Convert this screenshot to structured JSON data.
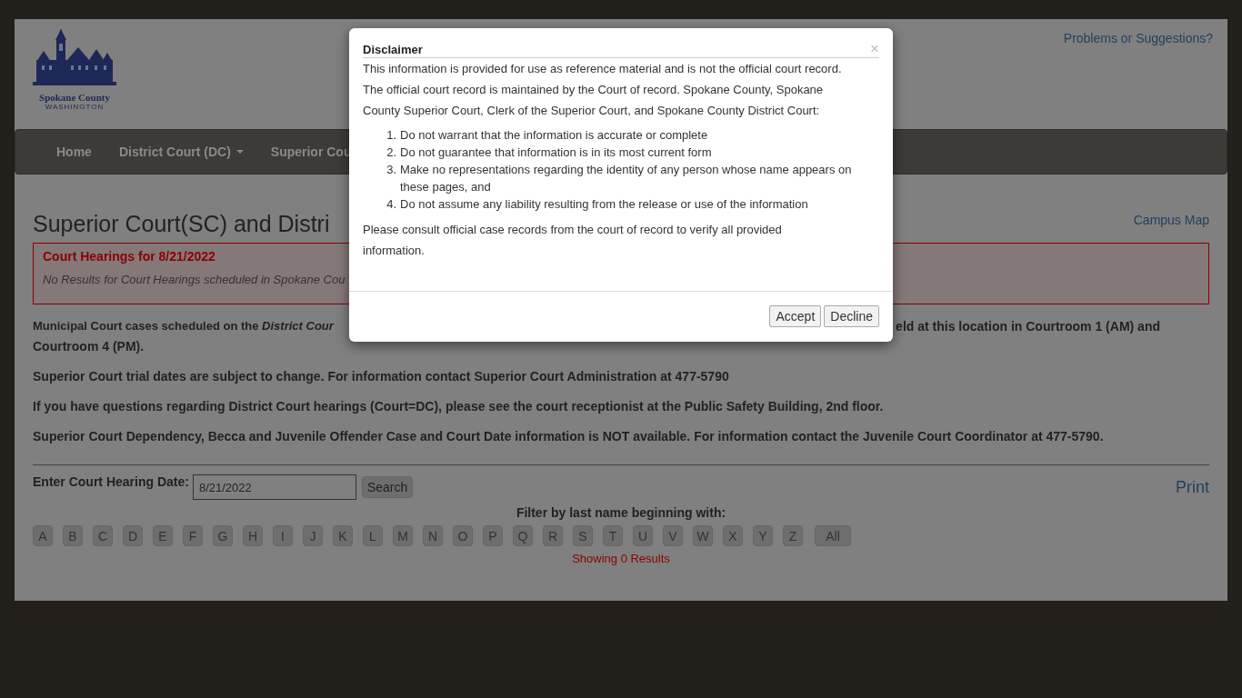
{
  "header": {
    "logo_name": "Spokane County",
    "logo_subtitle": "WASHINGTON",
    "link": "Problems or Suggestions?"
  },
  "nav": [
    {
      "label": "Home",
      "dropdown": false
    },
    {
      "label": "District Court (DC)",
      "dropdown": true
    },
    {
      "label": "Superior Cou",
      "dropdown": false
    }
  ],
  "heading": "Superior Court(SC) and Distri",
  "campus_link": "Campus Map",
  "alert": {
    "title": "Court Hearings for 8/21/2022",
    "message": "No Results for Court Hearings scheduled in Spokane Cou"
  },
  "municipal_notice": {
    "left": "Municipal Court cases scheduled on the *District Cour*",
    "right": "eld at this location in Courtroom 1 (AM) and",
    "second_line": "Courtroom 4 (PM)."
  },
  "notices": [
    "Superior Court trial dates are subject to change. For information contact Superior Court Administration at 477-5790",
    "If you have questions regarding District Court hearings (Court=DC), please see the court receptionist at the Public Safety Building, 2nd floor.",
    "Superior Court Dependency, Becca and Juvenile Offender Case and Court Date information is NOT available. For information contact the Juvenile Court Coordinator at 477-5790."
  ],
  "date_form": {
    "label": "Enter Court Hearing Date:",
    "value": "8/21/2022",
    "button": "Search"
  },
  "print_link": "Print",
  "filter": {
    "label": "Filter by last name beginning with:",
    "letters": [
      "A",
      "B",
      "C",
      "D",
      "E",
      "F",
      "G",
      "H",
      "I",
      "J",
      "K",
      "L",
      "M",
      "N",
      "O",
      "P",
      "Q",
      "R",
      "S",
      "T",
      "U",
      "V",
      "W",
      "X",
      "Y",
      "Z",
      "All"
    ],
    "result": "Showing 0 Results"
  },
  "modal": {
    "title": "Disclaimer",
    "close": "×",
    "intro": "This information is provided for use as reference material and is not the official court record. The official court record is maintained by the Court of record. Spokane County, Spokane County Superior Court, Clerk of the Superior Court, and Spokane County District Court:",
    "items": [
      {
        "number": "1.",
        "text": "Do not warrant that the information is accurate or complete"
      },
      {
        "number": "2.",
        "text": "Do not guarantee that information is in its most current form"
      },
      {
        "number": "3.",
        "text": "Make no representations regarding the identity of any person whose name appears on these pages, and"
      },
      {
        "number": "4.",
        "text": "Do not assume any liability resulting from the release or use of the information"
      }
    ],
    "outro": "Please consult official case records from the court of record to verify all provided information.",
    "buttons": [
      "Accept",
      "Decline"
    ]
  }
}
